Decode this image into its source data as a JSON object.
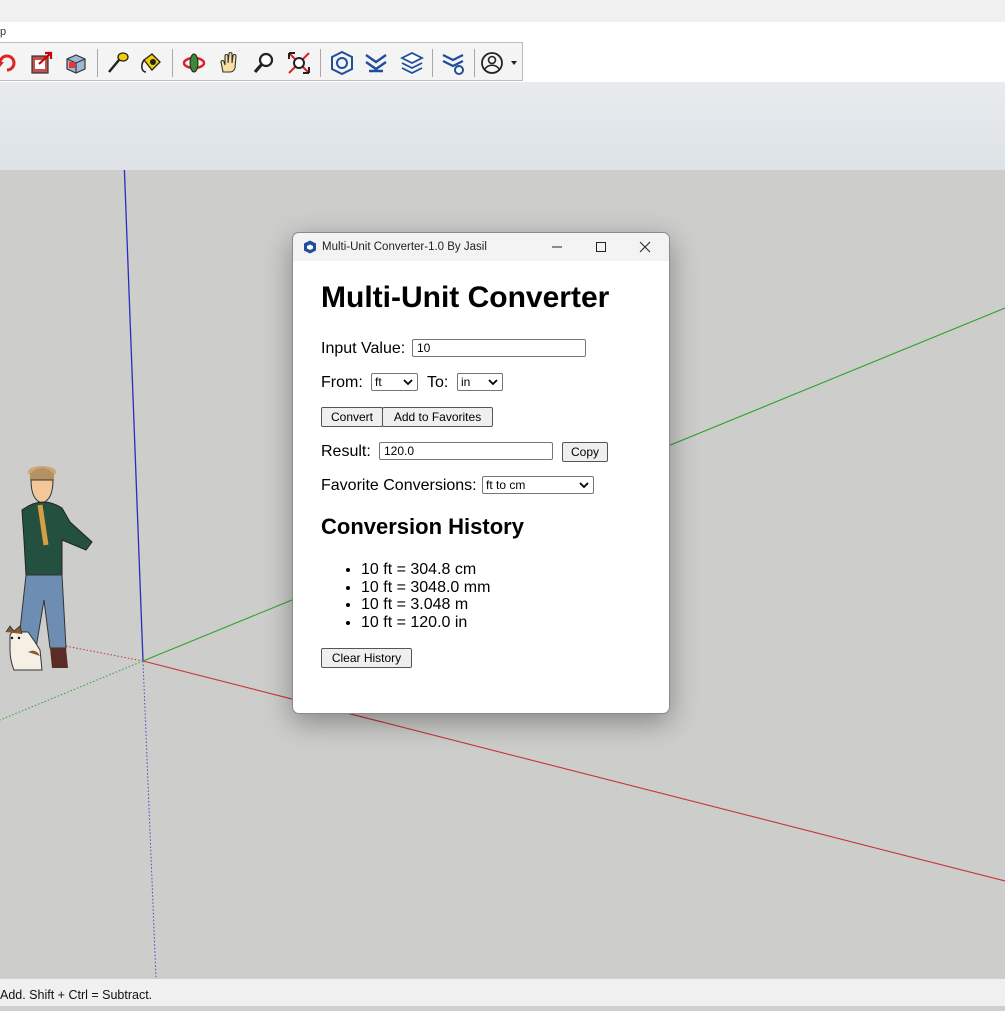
{
  "app": {
    "menu_fragment": "p",
    "status_text": "Add. Shift + Ctrl = Subtract."
  },
  "toolbar": {
    "icons": [
      "orbit-refresh-icon",
      "export-icon",
      "components-icon",
      "tape-measure-icon",
      "paint-bucket-icon",
      "orbit-icon",
      "pan-icon",
      "zoom-icon",
      "zoom-extents-icon",
      "warehouse-icon",
      "extension-icon",
      "layers-icon",
      "settings-icon",
      "account-icon"
    ]
  },
  "dialog": {
    "title": "Multi-Unit Converter-1.0 By Jasil",
    "heading": "Multi-Unit Converter",
    "input_label": "Input Value:",
    "input_value": "10",
    "from_label": "From:",
    "from_value": "ft",
    "to_label": "To:",
    "to_value": "in",
    "convert_label": "Convert",
    "favorites_add_label": "Add to Favorites",
    "result_label": "Result:",
    "result_value": "120.0",
    "copy_label": "Copy",
    "favorites_label": "Favorite Conversions:",
    "favorites_value": "ft to cm",
    "history_heading": "Conversion History",
    "history": [
      "10 ft = 304.8 cm",
      "10 ft = 3048.0 mm",
      "10 ft = 3.048 m",
      "10 ft = 120.0 in"
    ],
    "clear_label": "Clear History"
  },
  "colors": {
    "axis_blue": "#2b2bbf",
    "axis_green": "#2fa52f",
    "axis_red": "#c63535",
    "viewport_bg": "#cdcdcb"
  }
}
